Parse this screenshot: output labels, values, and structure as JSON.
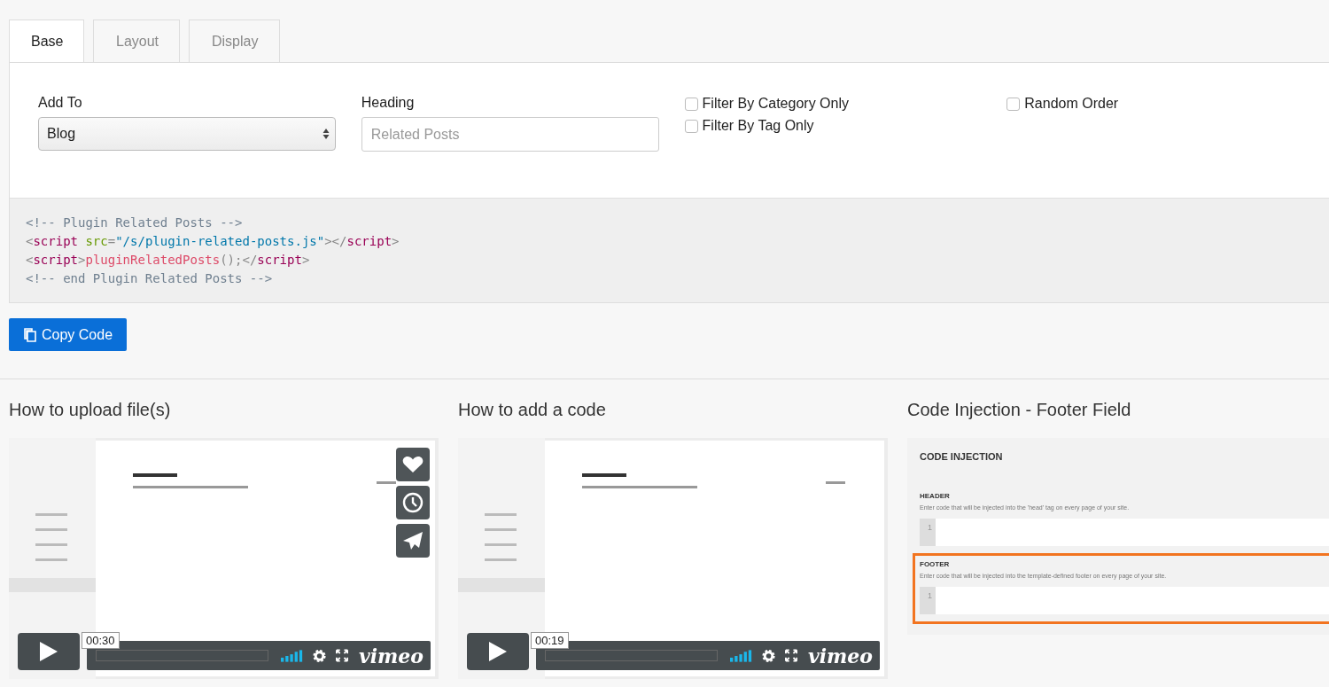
{
  "tabs": [
    {
      "label": "Base",
      "selected": true
    },
    {
      "label": "Layout",
      "selected": false
    },
    {
      "label": "Display",
      "selected": false
    }
  ],
  "form": {
    "add_to": {
      "label": "Add To",
      "value": "Blog"
    },
    "heading": {
      "label": "Heading",
      "placeholder": "Related Posts"
    },
    "option_columns": [
      [
        {
          "label": "Filter By Category Only",
          "checked": false
        },
        {
          "label": "Filter By Tag Only",
          "checked": false
        }
      ],
      [
        {
          "label": "Random Order",
          "checked": false
        }
      ]
    ]
  },
  "code": [
    [
      {
        "text": "<!-- Plugin Related Posts -->",
        "kind": "comment"
      }
    ],
    [
      {
        "text": "<",
        "kind": "punct"
      },
      {
        "text": "script",
        "kind": "tag"
      },
      {
        "text": " src",
        "kind": "attr"
      },
      {
        "text": "=",
        "kind": "punct"
      },
      {
        "text": "\"/s/plugin-related-posts.js\"",
        "kind": "string"
      },
      {
        "text": "></",
        "kind": "punct"
      },
      {
        "text": "script",
        "kind": "tag"
      },
      {
        "text": ">",
        "kind": "punct"
      }
    ],
    [
      {
        "text": "<",
        "kind": "punct"
      },
      {
        "text": "script",
        "kind": "tag"
      },
      {
        "text": ">",
        "kind": "punct"
      },
      {
        "text": "pluginRelatedPosts",
        "kind": "func"
      },
      {
        "text": "();</",
        "kind": "punct"
      },
      {
        "text": "script",
        "kind": "tag"
      },
      {
        "text": ">",
        "kind": "punct"
      }
    ],
    [
      {
        "text": "<!-- end Plugin Related Posts -->",
        "kind": "comment"
      }
    ]
  ],
  "copy_button": "Copy Code",
  "media": [
    {
      "kind": "video",
      "title": "How to upload file(s)",
      "time": "00:30",
      "brand": "vimeo",
      "side_buttons": true
    },
    {
      "kind": "video",
      "title": "How to add a code",
      "time": "00:19",
      "brand": "vimeo",
      "side_buttons": false
    },
    {
      "title": "Code Injection - Footer Field",
      "heading": "CODE INJECTION",
      "sections": [
        {
          "label": "HEADER",
          "description": "Enter code that will be injected into the 'head' tag on every page of your site.",
          "line_number": "1",
          "highlighted": false
        },
        {
          "label": "FOOTER",
          "description": "Enter code that will be injected into the template-defined footer on every page of your site.",
          "line_number": "1",
          "highlighted": true
        }
      ]
    }
  ]
}
